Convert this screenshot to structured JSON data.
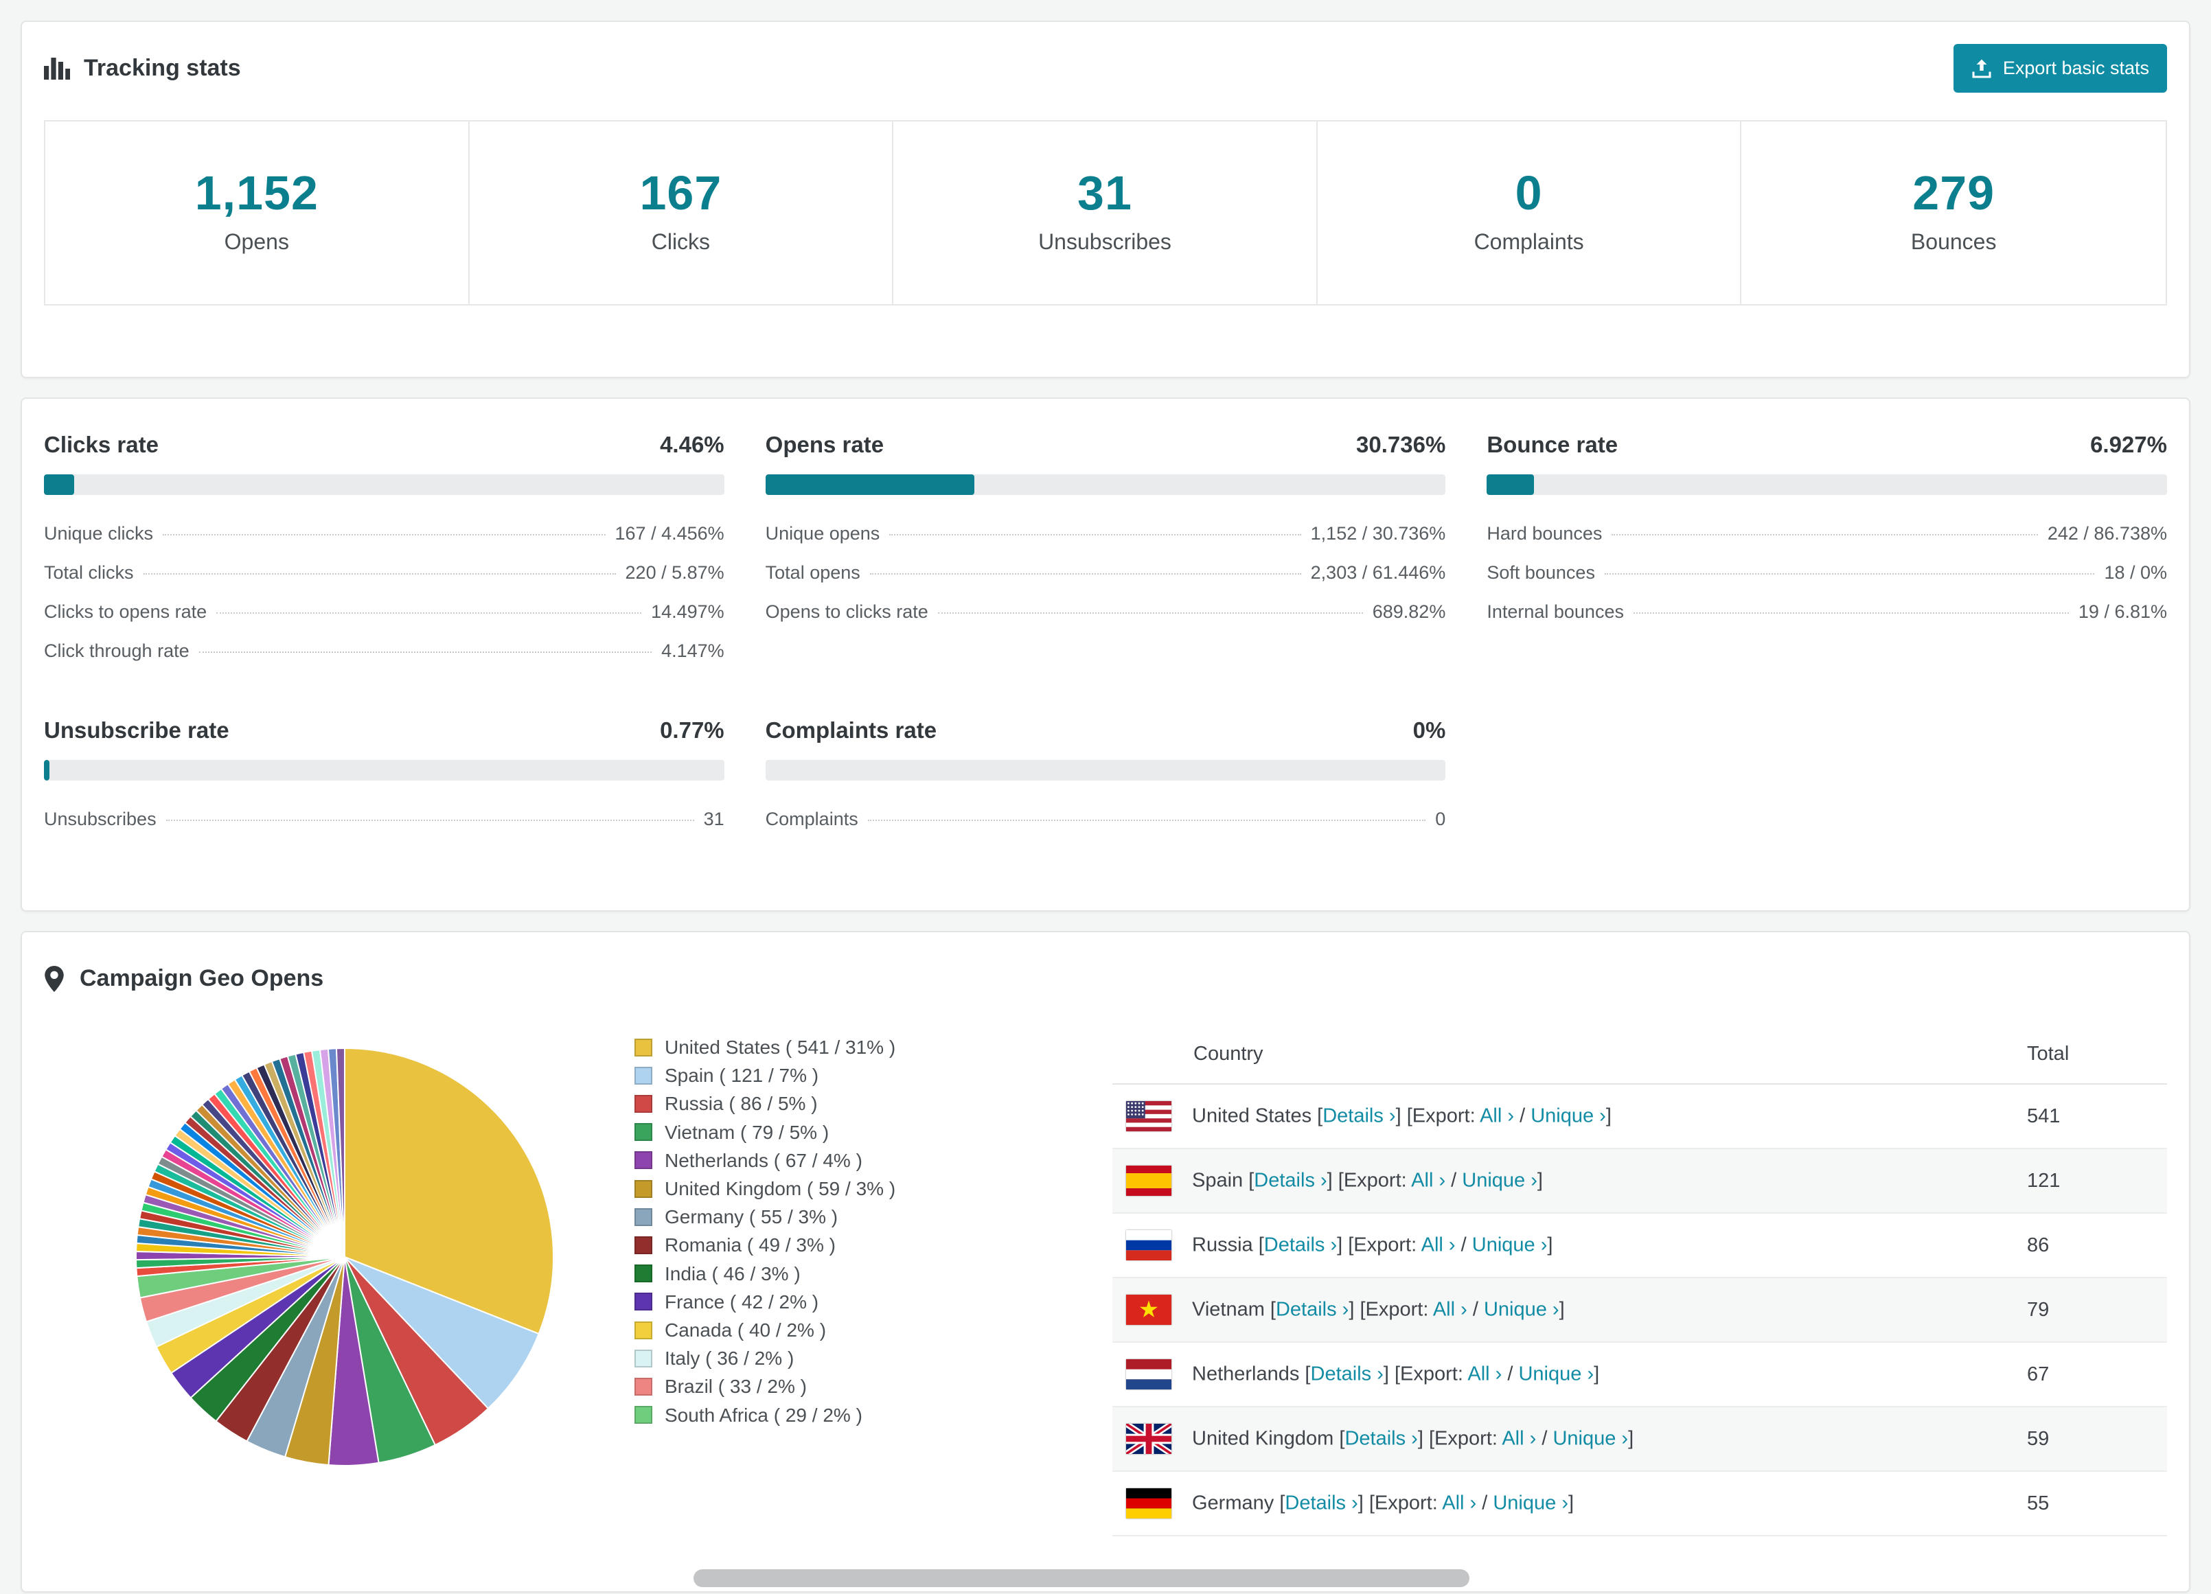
{
  "theme": {
    "accent": "#0c7f8e",
    "button_bg": "#0f8ca3",
    "link": "#128ba4",
    "page_bg": "#f4f5f5"
  },
  "tracking": {
    "title": "Tracking stats",
    "export_button_label": "Export basic stats",
    "stats": [
      {
        "value": "1,152",
        "label": "Opens"
      },
      {
        "value": "167",
        "label": "Clicks"
      },
      {
        "value": "31",
        "label": "Unsubscribes"
      },
      {
        "value": "0",
        "label": "Complaints"
      },
      {
        "value": "279",
        "label": "Bounces"
      }
    ]
  },
  "rates": [
    {
      "title": "Clicks rate",
      "value": "4.46%",
      "pct": 4.46,
      "rows": [
        {
          "label": "Unique clicks",
          "value": "167 / 4.456%"
        },
        {
          "label": "Total clicks",
          "value": "220 / 5.87%"
        },
        {
          "label": "Clicks to opens rate",
          "value": "14.497%"
        },
        {
          "label": "Click through rate",
          "value": "4.147%"
        }
      ]
    },
    {
      "title": "Opens rate",
      "value": "30.736%",
      "pct": 30.736,
      "rows": [
        {
          "label": "Unique opens",
          "value": "1,152 / 30.736%"
        },
        {
          "label": "Total opens",
          "value": "2,303 / 61.446%"
        },
        {
          "label": "Opens to clicks rate",
          "value": "689.82%"
        }
      ]
    },
    {
      "title": "Bounce rate",
      "value": "6.927%",
      "pct": 6.927,
      "rows": [
        {
          "label": "Hard bounces",
          "value": "242 / 86.738%"
        },
        {
          "label": "Soft bounces",
          "value": "18 / 0%"
        },
        {
          "label": "Internal bounces",
          "value": "19 / 6.81%"
        }
      ]
    },
    {
      "title": "Unsubscribe rate",
      "value": "0.77%",
      "pct": 0.77,
      "rows": [
        {
          "label": "Unsubscribes",
          "value": "31"
        }
      ]
    },
    {
      "title": "Complaints rate",
      "value": "0%",
      "pct": 0,
      "rows": [
        {
          "label": "Complaints",
          "value": "0"
        }
      ]
    }
  ],
  "geo": {
    "title": "Campaign Geo Opens",
    "table": {
      "headers": [
        "Country",
        "Total"
      ],
      "details_label": "Details ›",
      "export_label": "[Export:",
      "all_label": "All ›",
      "unique_label": "Unique ›",
      "punct": {
        "open": "[",
        "close": "]",
        "slash": "/"
      },
      "rows": [
        {
          "country": "United States",
          "flag": "us",
          "total": "541"
        },
        {
          "country": "Spain",
          "flag": "es",
          "total": "121"
        },
        {
          "country": "Russia",
          "flag": "ru",
          "total": "86"
        },
        {
          "country": "Vietnam",
          "flag": "vn",
          "total": "79"
        },
        {
          "country": "Netherlands",
          "flag": "nl",
          "total": "67"
        },
        {
          "country": "United Kingdom",
          "flag": "gb",
          "total": "59"
        },
        {
          "country": "Germany",
          "flag": "de",
          "total": "55"
        }
      ]
    },
    "chart_data": {
      "type": "pie",
      "title": "Campaign Geo Opens",
      "legend_position": "right",
      "labels": [
        "United States",
        "Spain",
        "Russia",
        "Vietnam",
        "Netherlands",
        "United Kingdom",
        "Germany",
        "Romania",
        "India",
        "France",
        "Canada",
        "Italy",
        "Brazil",
        "South Africa"
      ],
      "values": [
        541,
        121,
        86,
        79,
        67,
        59,
        55,
        49,
        46,
        42,
        40,
        36,
        33,
        29
      ],
      "percents": [
        31,
        7,
        5,
        5,
        4,
        3,
        3,
        3,
        3,
        2,
        2,
        2,
        2,
        2
      ],
      "colors": [
        "#e9c23f",
        "#aed3f1",
        "#cf4a47",
        "#3aa45c",
        "#8e44ad",
        "#c49a2b",
        "#8aa6bc",
        "#922f2d",
        "#1f7d33",
        "#5d35b0",
        "#f2d03d",
        "#d9f3f3",
        "#ef8582",
        "#6fce7e"
      ],
      "others": {
        "total": 462,
        "slices": 42,
        "palette": [
          "#e74c3c",
          "#27ae60",
          "#8e44ad",
          "#f1c40f",
          "#2980b9",
          "#e67e22",
          "#16a085",
          "#c0392b",
          "#2ecc71",
          "#9b59b6",
          "#f39c12",
          "#3498db",
          "#d35400",
          "#1abc9c",
          "#7f8c8d",
          "#e84393",
          "#6c5ce7",
          "#00b894",
          "#fdcb6e",
          "#0984e3",
          "#b33939",
          "#218c74",
          "#cc8e35",
          "#474787",
          "#ff5252",
          "#33d9b2",
          "#706fd3",
          "#ffb142",
          "#34ace0",
          "#40407a",
          "#ff793f",
          "#2c2c54",
          "#ccae62",
          "#227093",
          "#b33771",
          "#58b19f",
          "#3b3b98",
          "#fd7272",
          "#9aecdb",
          "#d6a2e8",
          "#6a89cc",
          "#82589f"
        ]
      }
    }
  }
}
